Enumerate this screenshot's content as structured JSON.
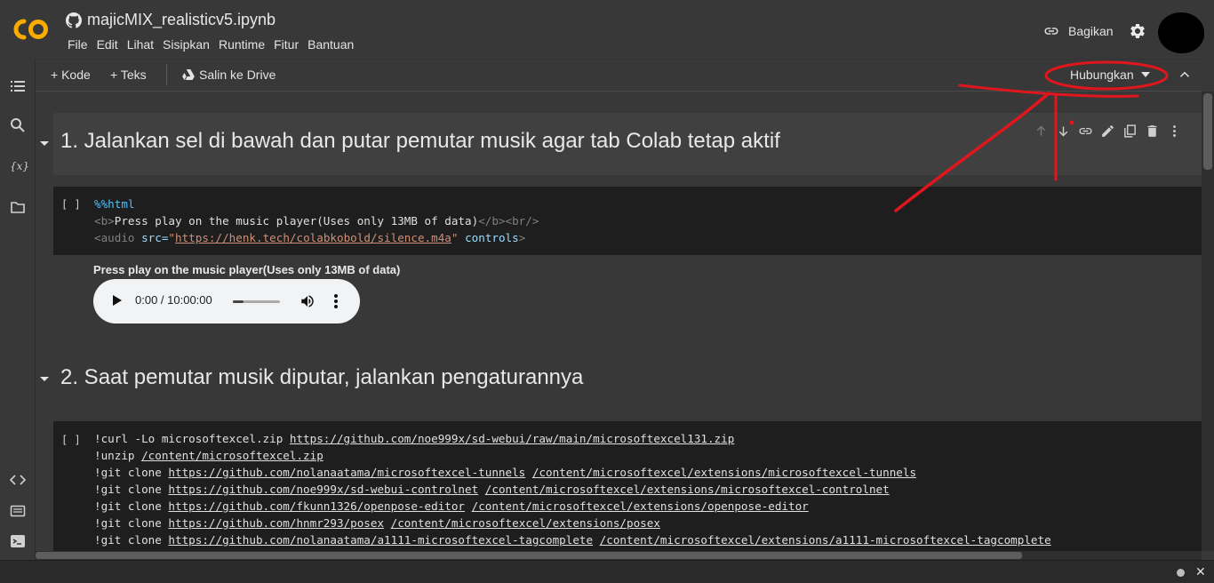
{
  "header": {
    "title": "majicMIX_realisticv5.ipynb",
    "logo_text": "CO",
    "menu": [
      "File",
      "Edit",
      "Lihat",
      "Sisipkan",
      "Runtime",
      "Fitur",
      "Bantuan"
    ],
    "share_label": "Bagikan"
  },
  "toolbar": {
    "add_code": "+ Kode",
    "add_text": "+ Teks",
    "copy_drive": "Salin ke Drive",
    "connect": "Hubungkan"
  },
  "sections": {
    "h1": "1. Jalankan sel di bawah dan putar pemutar musik agar tab Colab tetap aktif",
    "h2": "2. Saat pemutar musik diputar, jalankan pengaturannya"
  },
  "cell1": {
    "run_marker": "[ ]",
    "magic": "%%html",
    "line2_open": "<b>",
    "line2_text": "Press play on the music player(Uses only 13MB of data)",
    "line2_close": "</b><br/>",
    "line3_tag": "<audio ",
    "line3_attr": "src=",
    "line3_str_open": "\"",
    "line3_url": "https://henk.tech/colabkobold/silence.m4a",
    "line3_str_close": "\"",
    "line3_attr2": " controls",
    "line3_end": ">",
    "output_text": "Press play on the music player(Uses only 13MB of data)",
    "player_time": "0:00 / 10:00:00",
    "player_progress": 0.22
  },
  "cell2": {
    "run_marker": "[ ]",
    "lines": [
      {
        "pre": "!curl -Lo microsoftexcel.zip ",
        "link": "https://github.com/noe999x/sd-webui/raw/main/microsoftexcel131.zip",
        "sep": "",
        "path": ""
      },
      {
        "pre": "!unzip ",
        "link": "/content/microsoftexcel.zip",
        "sep": "",
        "path": ""
      },
      {
        "pre": "!git clone ",
        "link": "https://github.com/nolanaatama/microsoftexcel-tunnels",
        "sep": " ",
        "path": "/content/microsoftexcel/extensions/microsoftexcel-tunnels"
      },
      {
        "pre": "!git clone ",
        "link": "https://github.com/noe999x/sd-webui-controlnet",
        "sep": " ",
        "path": "/content/microsoftexcel/extensions/microsoftexcel-controlnet"
      },
      {
        "pre": "!git clone ",
        "link": "https://github.com/fkunn1326/openpose-editor",
        "sep": " ",
        "path": "/content/microsoftexcel/extensions/openpose-editor"
      },
      {
        "pre": "!git clone ",
        "link": "https://github.com/hnmr293/posex",
        "sep": " ",
        "path": "/content/microsoftexcel/extensions/posex"
      },
      {
        "pre": "!git clone ",
        "link": "https://github.com/nolanaatama/a1111-microsoftexcel-tagcomplete",
        "sep": " ",
        "path": "/content/microsoftexcel/extensions/a1111-microsoftexcel-tagcomplete"
      }
    ]
  },
  "icons": {
    "rail": [
      "toc-icon",
      "search-icon",
      "variables-icon",
      "folder-icon",
      "code-snippets-icon",
      "command-palette-icon",
      "terminal-icon"
    ],
    "cell_toolbar": [
      "move-up-icon",
      "move-down-icon",
      "link-icon",
      "edit-icon",
      "mirror-cell-icon",
      "delete-icon",
      "more-vert-icon"
    ]
  },
  "colors": {
    "background": "#383838",
    "code_background": "#1e1e1e",
    "accent_logo": "#f9ab00",
    "annotation": "#e0161d"
  }
}
